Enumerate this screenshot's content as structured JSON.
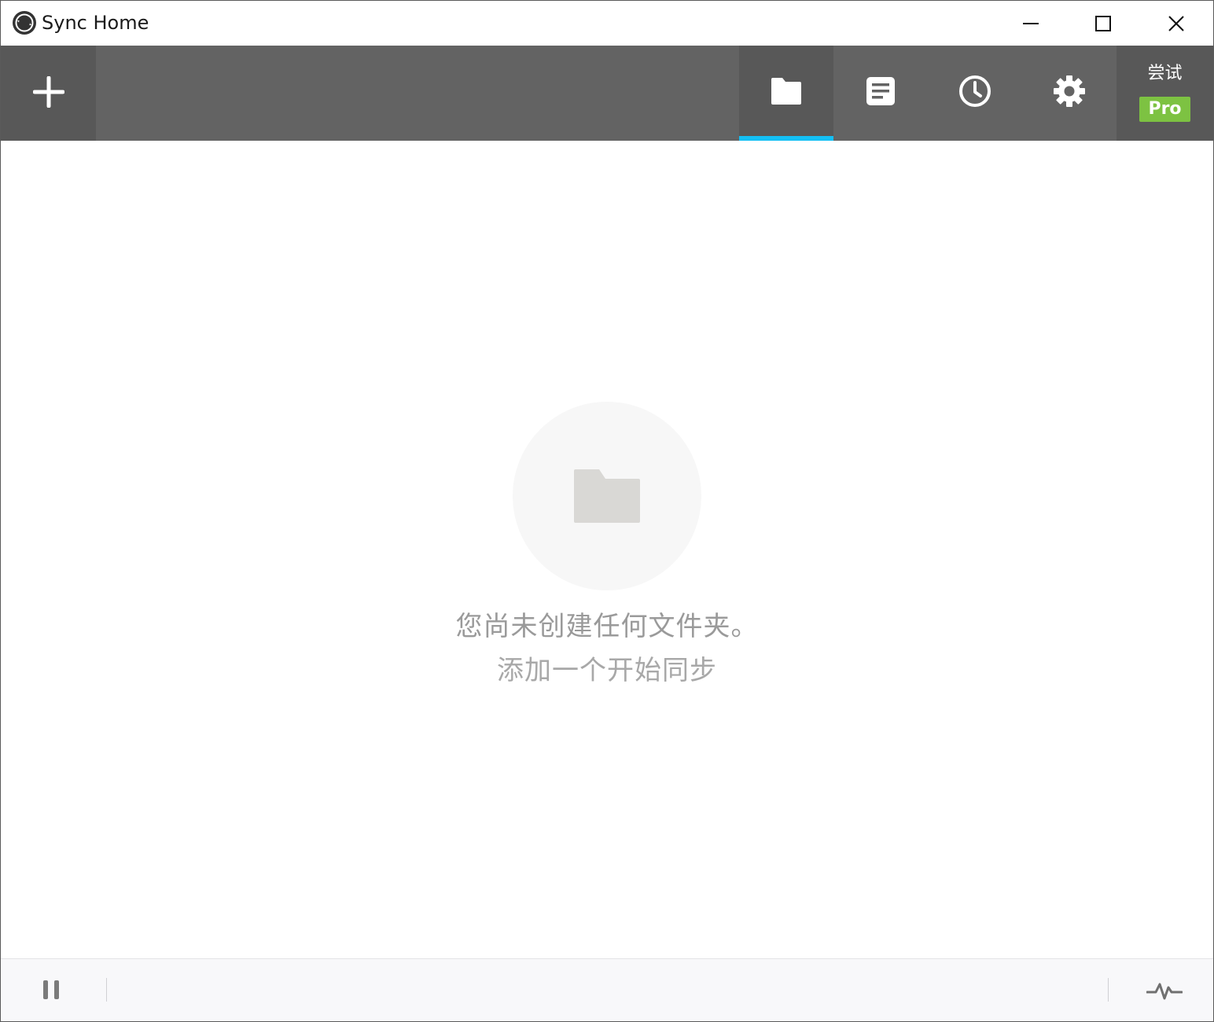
{
  "window": {
    "title": "Sync Home",
    "controls": {
      "minimize_icon": "minimize-icon",
      "maximize_icon": "maximize-icon",
      "close_icon": "close-icon"
    }
  },
  "toolbar": {
    "add_icon": "plus-icon",
    "tabs": [
      {
        "id": "folders",
        "icon": "folder-icon",
        "active": true
      },
      {
        "id": "log",
        "icon": "document-icon",
        "active": false
      },
      {
        "id": "history",
        "icon": "clock-icon",
        "active": false
      },
      {
        "id": "settings",
        "icon": "gear-icon",
        "active": false
      }
    ],
    "try_label": "尝试",
    "pro_label": "Pro"
  },
  "empty_state": {
    "icon": "folder-icon",
    "line1": "您尚未创建任何文件夹。",
    "line2": "添加一个开始同步"
  },
  "statusbar": {
    "pause_icon": "pause-icon",
    "activity_icon": "activity-pulse-icon"
  },
  "colors": {
    "toolbar_bg": "#636363",
    "toolbar_section_bg": "#585858",
    "active_tab_underline": "#14bff4",
    "pro_badge": "#7dc242",
    "empty_text": "#9a9a9a",
    "empty_icon": "#d9d8d5"
  }
}
